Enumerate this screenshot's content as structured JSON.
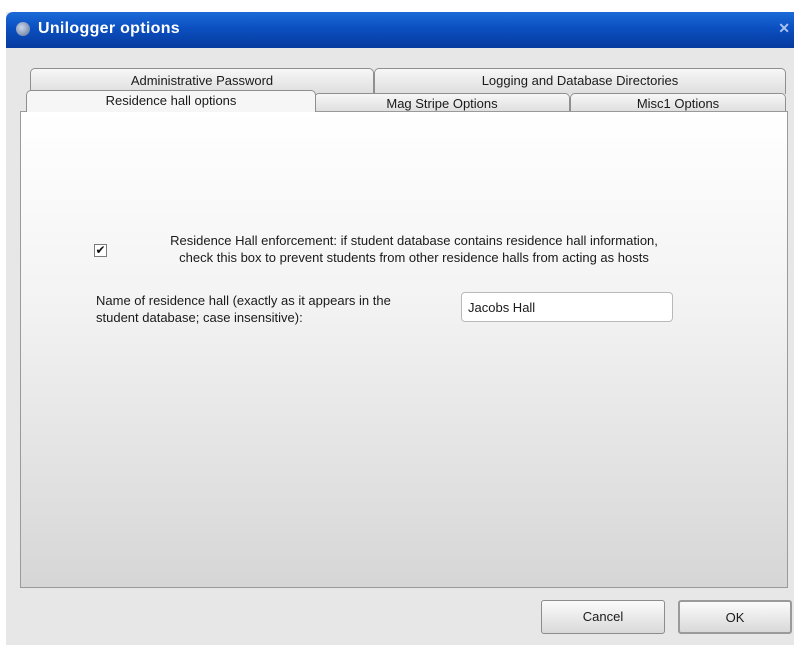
{
  "window": {
    "title": "Unilogger options"
  },
  "tabs_back": [
    {
      "label": "Administrative Password"
    },
    {
      "label": "Logging and Database Directories"
    }
  ],
  "tabs_front": [
    {
      "label": "Residence hall options",
      "active": true
    },
    {
      "label": "Mag Stripe Options",
      "active": false
    },
    {
      "label": "Misc1 Options",
      "active": false
    }
  ],
  "residence": {
    "enforcement_checked": true,
    "enforcement_line1": "Residence Hall enforcement: if student database contains residence hall information,",
    "enforcement_line2": "check this box to prevent students from other residence halls from acting as hosts",
    "name_label_line1": "Name of residence hall (exactly as it appears in the",
    "name_label_line2": "student database; case insensitive):",
    "name_value": "Jacobs Hall"
  },
  "buttons": {
    "cancel": "Cancel",
    "ok": "OK"
  },
  "icons": {
    "app": "app-icon",
    "close": "close-icon",
    "check": "checkmark-icon"
  }
}
